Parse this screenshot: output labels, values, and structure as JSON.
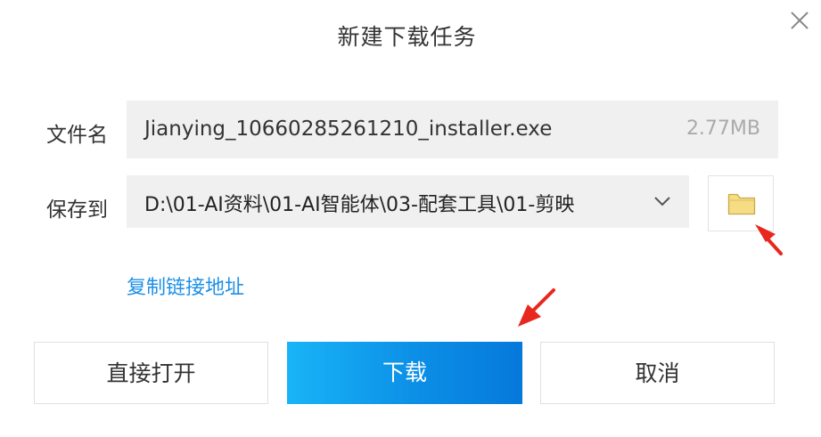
{
  "dialog": {
    "title": "新建下载任务",
    "close_icon": "close-icon"
  },
  "file": {
    "label": "文件名",
    "name": "Jianying_10660285261210_installer.exe",
    "size": "2.77MB"
  },
  "save": {
    "label": "保存到",
    "path": "D:\\01-AI资料\\01-AI智能体\\03-配套工具\\01-剪映",
    "dropdown_icon": "chevron-down-icon",
    "browse_icon": "folder-icon"
  },
  "copy_link_label": "复制链接地址",
  "buttons": {
    "open_label": "直接打开",
    "download_label": "下载",
    "cancel_label": "取消"
  },
  "colors": {
    "accent": "#0c8fe6",
    "link": "#1e90e6",
    "annotation_arrow": "#e8271f",
    "folder": "#f6dc83"
  }
}
